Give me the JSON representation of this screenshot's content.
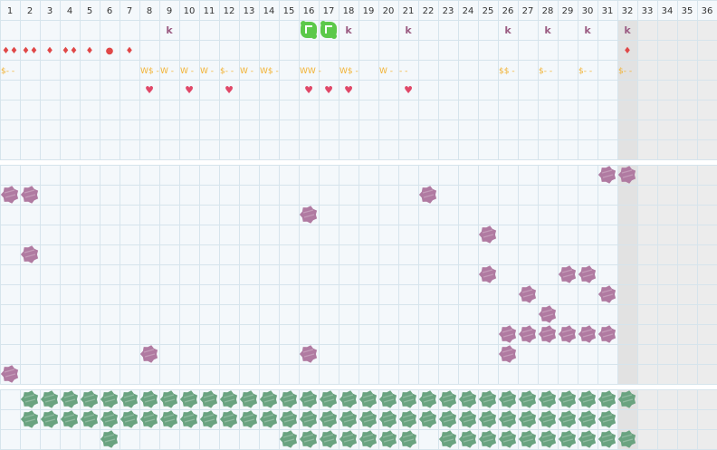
{
  "columns": [
    "1",
    "2",
    "3",
    "4",
    "5",
    "6",
    "7",
    "8",
    "9",
    "10",
    "11",
    "12",
    "13",
    "14",
    "15",
    "16",
    "17",
    "18",
    "19",
    "20",
    "21",
    "22",
    "23",
    "24",
    "25",
    "26",
    "27",
    "28",
    "29",
    "30",
    "31",
    "32",
    "33",
    "34",
    "35",
    "36"
  ],
  "active_columns": 32,
  "colors": {
    "grid_line": "#d6e4ec",
    "cell_bg": "#f4f8fb",
    "inactive_bg": "#ececec",
    "inactive_col_highlight": "#e2e2e2",
    "header_bg": "#f4f8fb",
    "section_divider": "#f7f7f7",
    "purple_blob": "#b07aa1",
    "green_blob": "#6aa380",
    "bright_green": "#5cc94a",
    "k_color": "#9b5c82",
    "drop_color": "#e04848",
    "dollar_color": "#f2b233",
    "heart_color": "#e04868"
  },
  "top_section": {
    "row_k": [
      {
        "col": 9,
        "text": "k"
      },
      {
        "col": 16,
        "text": "",
        "icon": "green-creature-icon"
      },
      {
        "col": 17,
        "text": "",
        "icon": "green-creature-icon"
      },
      {
        "col": 18,
        "text": "k"
      },
      {
        "col": 21,
        "text": "k"
      },
      {
        "col": 26,
        "text": "k"
      },
      {
        "col": 28,
        "text": "k"
      },
      {
        "col": 30,
        "text": "k"
      },
      {
        "col": 32,
        "text": "k"
      }
    ],
    "row_drops": [
      {
        "col": 1,
        "text": "♦♦"
      },
      {
        "col": 2,
        "text": "♦♦"
      },
      {
        "col": 3,
        "text": "♦"
      },
      {
        "col": 4,
        "text": "♦♦"
      },
      {
        "col": 5,
        "text": "♦"
      },
      {
        "col": 6,
        "text": "●"
      },
      {
        "col": 7,
        "text": "♦"
      },
      {
        "col": 32,
        "text": "♦"
      }
    ],
    "row_money": [
      {
        "col": 1,
        "text": "$- -"
      },
      {
        "col": 8,
        "text": "W$ -"
      },
      {
        "col": 9,
        "text": "W -"
      },
      {
        "col": 10,
        "text": "W -"
      },
      {
        "col": 11,
        "text": "W -"
      },
      {
        "col": 12,
        "text": "$- -"
      },
      {
        "col": 13,
        "text": "W -"
      },
      {
        "col": 14,
        "text": "W$ -"
      },
      {
        "col": 16,
        "text": "WW -"
      },
      {
        "col": 18,
        "text": "W$ -"
      },
      {
        "col": 20,
        "text": "W -"
      },
      {
        "col": 21,
        "text": "- -"
      },
      {
        "col": 26,
        "text": "$$ -"
      },
      {
        "col": 28,
        "text": "$- -"
      },
      {
        "col": 30,
        "text": "$- -"
      },
      {
        "col": 32,
        "text": "$- -"
      }
    ],
    "row_hearts": [
      8,
      10,
      12,
      16,
      17,
      18,
      21
    ]
  },
  "middle_section": {
    "blobs": [
      {
        "row": 1,
        "col": 31
      },
      {
        "row": 1,
        "col": 32
      },
      {
        "row": 2,
        "col": 1
      },
      {
        "row": 2,
        "col": 2
      },
      {
        "row": 2,
        "col": 22
      },
      {
        "row": 3,
        "col": 16
      },
      {
        "row": 4,
        "col": 25
      },
      {
        "row": 5,
        "col": 2
      },
      {
        "row": 6,
        "col": 25
      },
      {
        "row": 6,
        "col": 29
      },
      {
        "row": 6,
        "col": 30
      },
      {
        "row": 7,
        "col": 27
      },
      {
        "row": 7,
        "col": 31
      },
      {
        "row": 8,
        "col": 28
      },
      {
        "row": 9,
        "col": 26
      },
      {
        "row": 9,
        "col": 27
      },
      {
        "row": 9,
        "col": 28
      },
      {
        "row": 9,
        "col": 29
      },
      {
        "row": 9,
        "col": 30
      },
      {
        "row": 9,
        "col": 31
      },
      {
        "row": 10,
        "col": 8
      },
      {
        "row": 10,
        "col": 16
      },
      {
        "row": 10,
        "col": 26
      },
      {
        "row": 11,
        "col": 1
      }
    ]
  },
  "bottom_section": {
    "row1": [
      2,
      3,
      4,
      5,
      6,
      7,
      8,
      9,
      10,
      11,
      12,
      13,
      14,
      15,
      16,
      17,
      18,
      19,
      20,
      21,
      22,
      23,
      24,
      25,
      26,
      27,
      28,
      29,
      30,
      31,
      32
    ],
    "row2": [
      2,
      3,
      4,
      5,
      6,
      7,
      8,
      9,
      10,
      11,
      12,
      13,
      14,
      15,
      16,
      17,
      18,
      19,
      20,
      21,
      22,
      23,
      24,
      25,
      26,
      27,
      28,
      29,
      30,
      31
    ],
    "row3": [
      6,
      15,
      16,
      17,
      18,
      19,
      20,
      21,
      23,
      24,
      25,
      26,
      27,
      28,
      29,
      30,
      31,
      32
    ]
  }
}
